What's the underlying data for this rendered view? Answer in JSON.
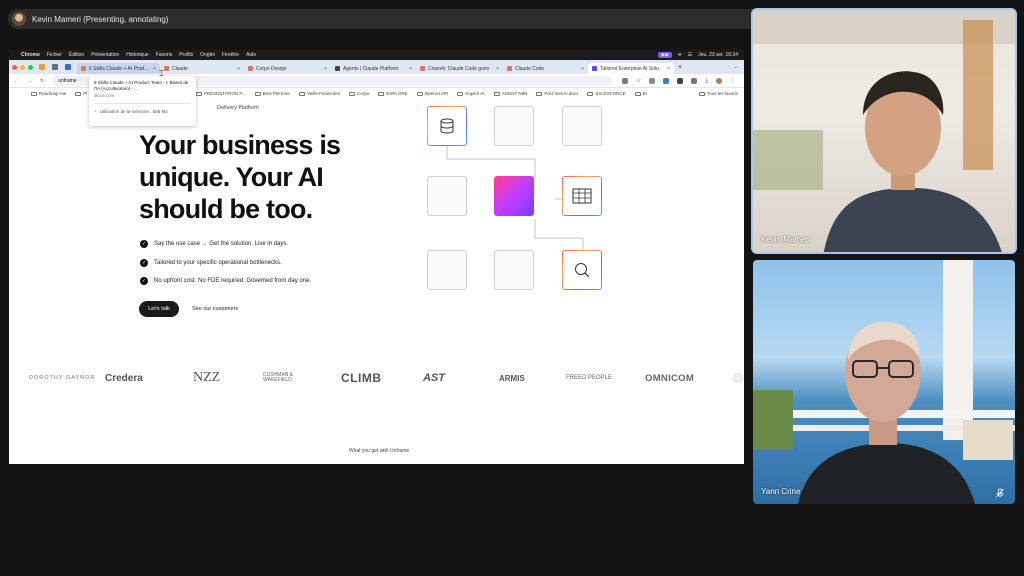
{
  "presenter": {
    "label": "Kevin Mameri (Presenting, annotating)"
  },
  "mac_menubar": {
    "app": "Chrome",
    "menus": [
      "Fichier",
      "Édition",
      "Présentation",
      "Historique",
      "Favoris",
      "Profils",
      "Onglet",
      "Fenêtre",
      "Aide"
    ],
    "datetime": "Jeu. 23 avr.  16:34"
  },
  "browser": {
    "tabs": [
      {
        "label": "6 Skills Claude + AI Product Team",
        "state": "hover",
        "color": "#e77d3c"
      },
      {
        "label": "Claude",
        "state": "normal",
        "color": "#d97757"
      },
      {
        "label": "Corpo Design",
        "state": "normal",
        "color": "#d97757"
      },
      {
        "label": "Agents | Claude Platform",
        "state": "normal",
        "color": "#444444"
      },
      {
        "label": "Cowork: Claude Code goes",
        "state": "normal",
        "color": "#d97757"
      },
      {
        "label": "Claude Code",
        "state": "normal",
        "color": "#d97757"
      },
      {
        "label": "Tailored Enterprise AI Solu",
        "state": "active",
        "color": "#6b3cff"
      }
    ],
    "url": "unframe",
    "bookmarks": [
      "Roadmap AIe",
      "Pl",
      "ERFO",
      "PRÉSENTATION P...",
      "Best PM Ever",
      "Veille Financière",
      "Corpo",
      "EXPLORE",
      "OpenAI API",
      "Copilot IA",
      "AGENT N8N",
      "Prez GenAI.docx",
      "SALESFORCE",
      "BI"
    ],
    "all_bookmarks": "Tous les favoris"
  },
  "tab_tooltip": {
    "title": "6 Skills Claude + AI Product Team - I. Bases de l'IA (Acculturation) - ...",
    "domain": "skool.com",
    "memory": "Utilisation de la mémoire : 586 Mo"
  },
  "page": {
    "delivery_label": "Delivery Platform",
    "hero_lines": [
      "Your business is",
      "unique. Your AI",
      "should be too."
    ],
    "bullets": [
      "Say the use case → Get the solution. Live in days.",
      "Tailored to your specific operational bottlenecks.",
      "No upfront cost. No FDE required. Governed from day one."
    ],
    "cta_label": "Let's talk",
    "secondary_link": "See our customers",
    "logos": [
      "DOROTHY GAYNOR",
      "Credera",
      "NZZ",
      "CUSHMAN & WAKEFIELD",
      "CLIMB",
      "AST",
      "ARMIS",
      "FREED PEOPLE",
      "OMNICOM"
    ],
    "footer_tab": "What you get with Unframe"
  },
  "participants": [
    {
      "name": "Kevin Mameri"
    },
    {
      "name": "Yann Crine"
    }
  ]
}
